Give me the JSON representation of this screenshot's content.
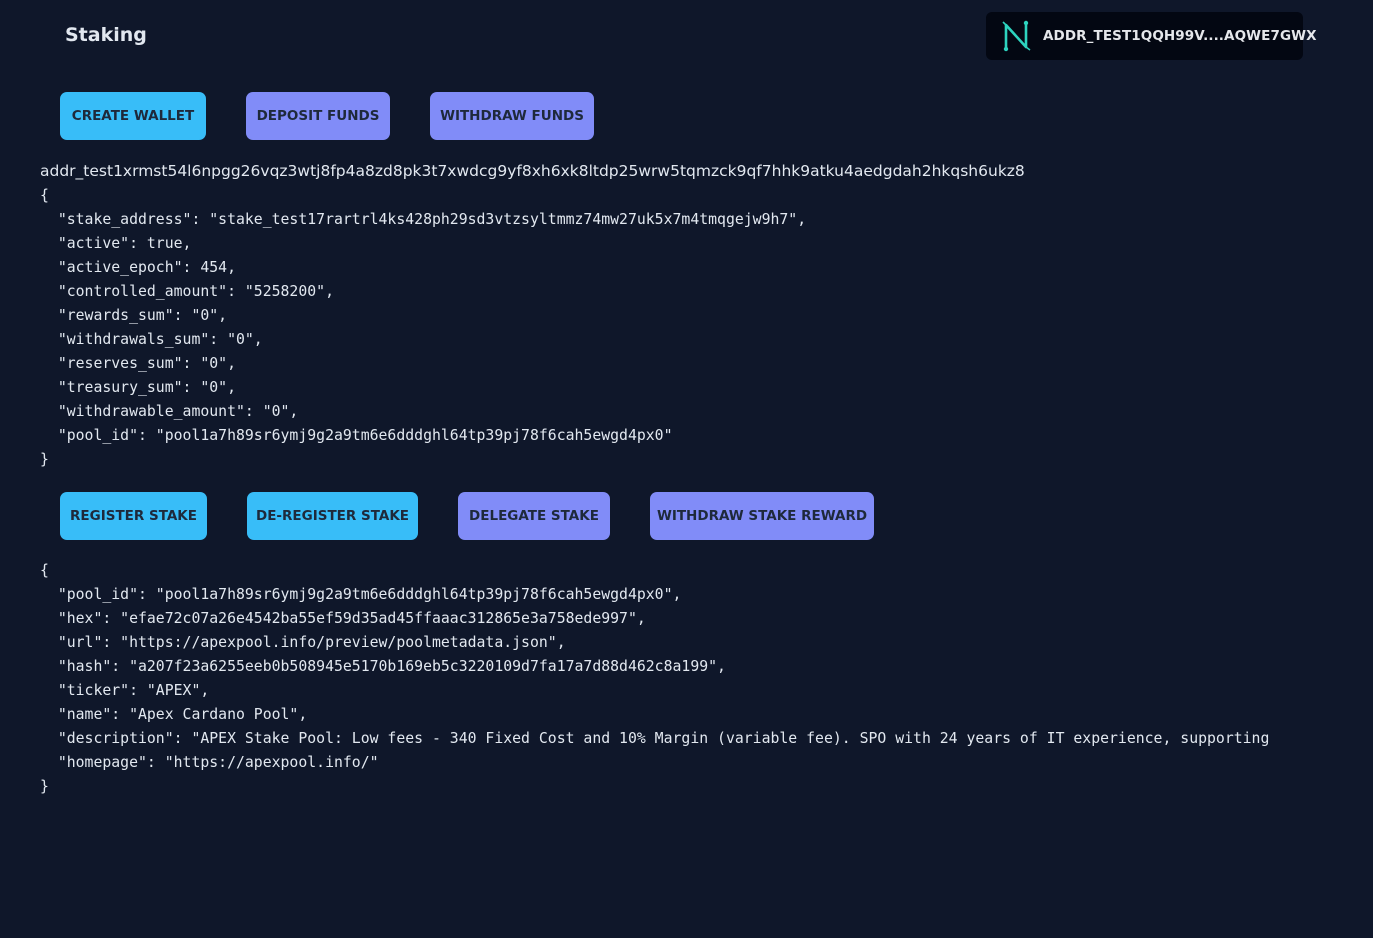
{
  "header": {
    "title": "Staking",
    "wallet_address": "ADDR_TEST1QQH99V....AQWE7GWX"
  },
  "wallet_actions": {
    "create_wallet": "CREATE WALLET",
    "deposit_funds": "DEPOSIT FUNDS",
    "withdraw_funds": "WITHDRAW FUNDS"
  },
  "address": "addr_test1xrmst54l6npgg26vqz3wtj8fp4a8zd8pk3t7xwdcg9yf8xh6xk8ltdp25wrw5tqmzck9qf7hhk9atku4aedgdah2hkqsh6ukz8",
  "account_json": [
    "{",
    "  \"stake_address\": \"stake_test17rartrl4ks428ph29sd3vtzsyltmmz74mw27uk5x7m4tmqgejw9h7\",",
    "  \"active\": true,",
    "  \"active_epoch\": 454,",
    "  \"controlled_amount\": \"5258200\",",
    "  \"rewards_sum\": \"0\",",
    "  \"withdrawals_sum\": \"0\",",
    "  \"reserves_sum\": \"0\",",
    "  \"treasury_sum\": \"0\",",
    "  \"withdrawable_amount\": \"0\",",
    "  \"pool_id\": \"pool1a7h89sr6ymj9g2a9tm6e6dddghl64tp39pj78f6cah5ewgd4px0\"",
    "}"
  ],
  "stake_actions": {
    "register_stake": "REGISTER STAKE",
    "deregister_stake": "DE-REGISTER STAKE",
    "delegate_stake": "DELEGATE STAKE",
    "withdraw_stake_reward": "WITHDRAW STAKE REWARD"
  },
  "pool_json": [
    "{",
    "  \"pool_id\": \"pool1a7h89sr6ymj9g2a9tm6e6dddghl64tp39pj78f6cah5ewgd4px0\",",
    "  \"hex\": \"efae72c07a26e4542ba55ef59d35ad45ffaaac312865e3a758ede997\",",
    "  \"url\": \"https://apexpool.info/preview/poolmetadata.json\",",
    "  \"hash\": \"a207f23a6255eeb0b508945e5170b169eb5c3220109d7fa17a7d88d462c8a199\",",
    "  \"ticker\": \"APEX\",",
    "  \"name\": \"Apex Cardano Pool\",",
    "  \"description\": \"APEX Stake Pool: Low fees - 340 Fixed Cost and 10% Margin (variable fee). SPO with 24 years of IT experience, supporting",
    "  \"homepage\": \"https://apexpool.info/\"",
    "}"
  ]
}
